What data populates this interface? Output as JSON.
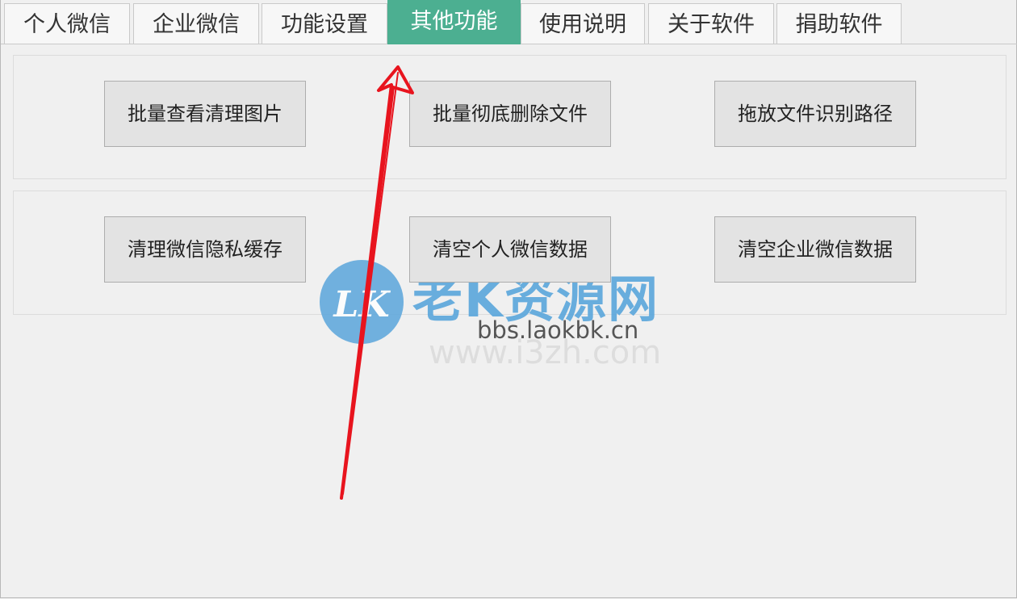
{
  "tabs": [
    "个人微信",
    "企业微信",
    "功能设置",
    "其他功能",
    "使用说明",
    "关于软件",
    "捐助软件"
  ],
  "active_tab": "其他功能",
  "buttons": {
    "row1": [
      "批量查看清理图片",
      "批量彻底删除文件",
      "拖放文件识别路径"
    ],
    "row2": [
      "清理微信隐私缓存",
      "清空个人微信数据",
      "清空企业微信数据"
    ]
  },
  "watermark": {
    "logo_text": "LK",
    "title": "老K资源网",
    "url": "bbs.laokbk.cn",
    "url_faint": "www.i3zh.com"
  },
  "colors": {
    "active_tab": "#4caf91",
    "annotation_arrow": "#e8141e",
    "watermark": "#5aa6dc"
  }
}
